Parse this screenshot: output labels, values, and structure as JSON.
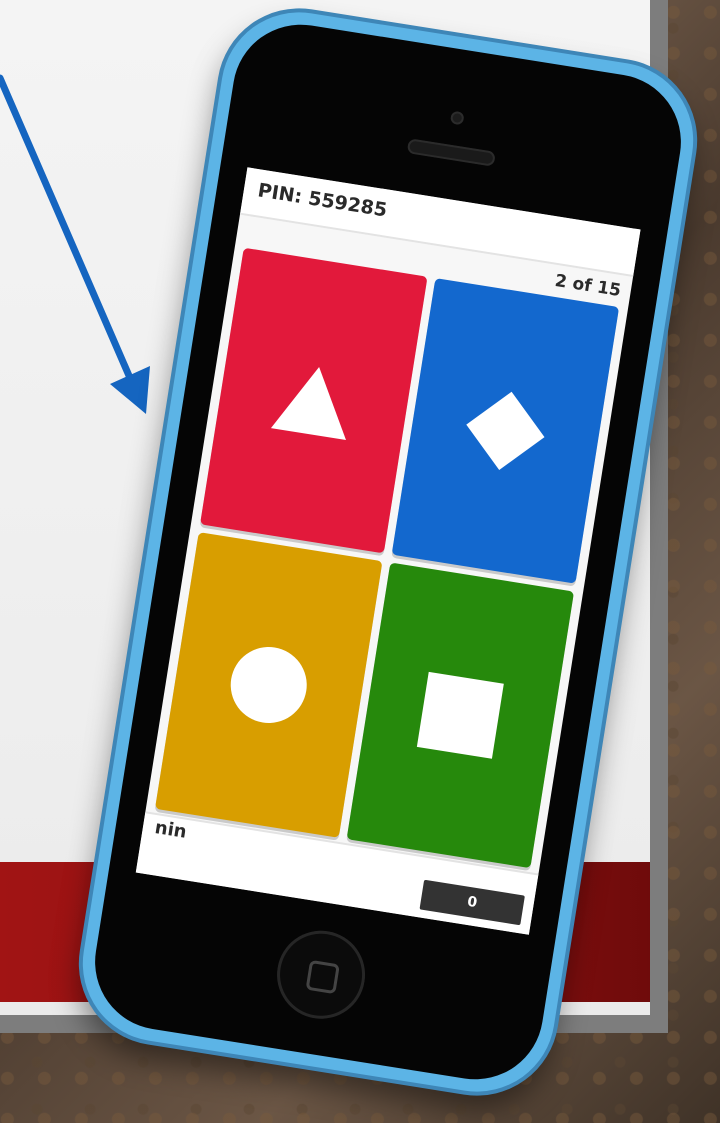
{
  "game": {
    "pin": "PIN: 559285",
    "progress": "2 of 15",
    "nickname": "nin",
    "score": "0"
  },
  "answers": [
    {
      "color": "#e2193b",
      "shape": "triangle"
    },
    {
      "color": "#1368ce",
      "shape": "diamond"
    },
    {
      "color": "#d89e00",
      "shape": "circle"
    },
    {
      "color": "#26890c",
      "shape": "square"
    }
  ],
  "colors": {
    "phone_case": "#5cb4e6",
    "slide_band": "#a11414",
    "arrow": "#1565c0"
  }
}
